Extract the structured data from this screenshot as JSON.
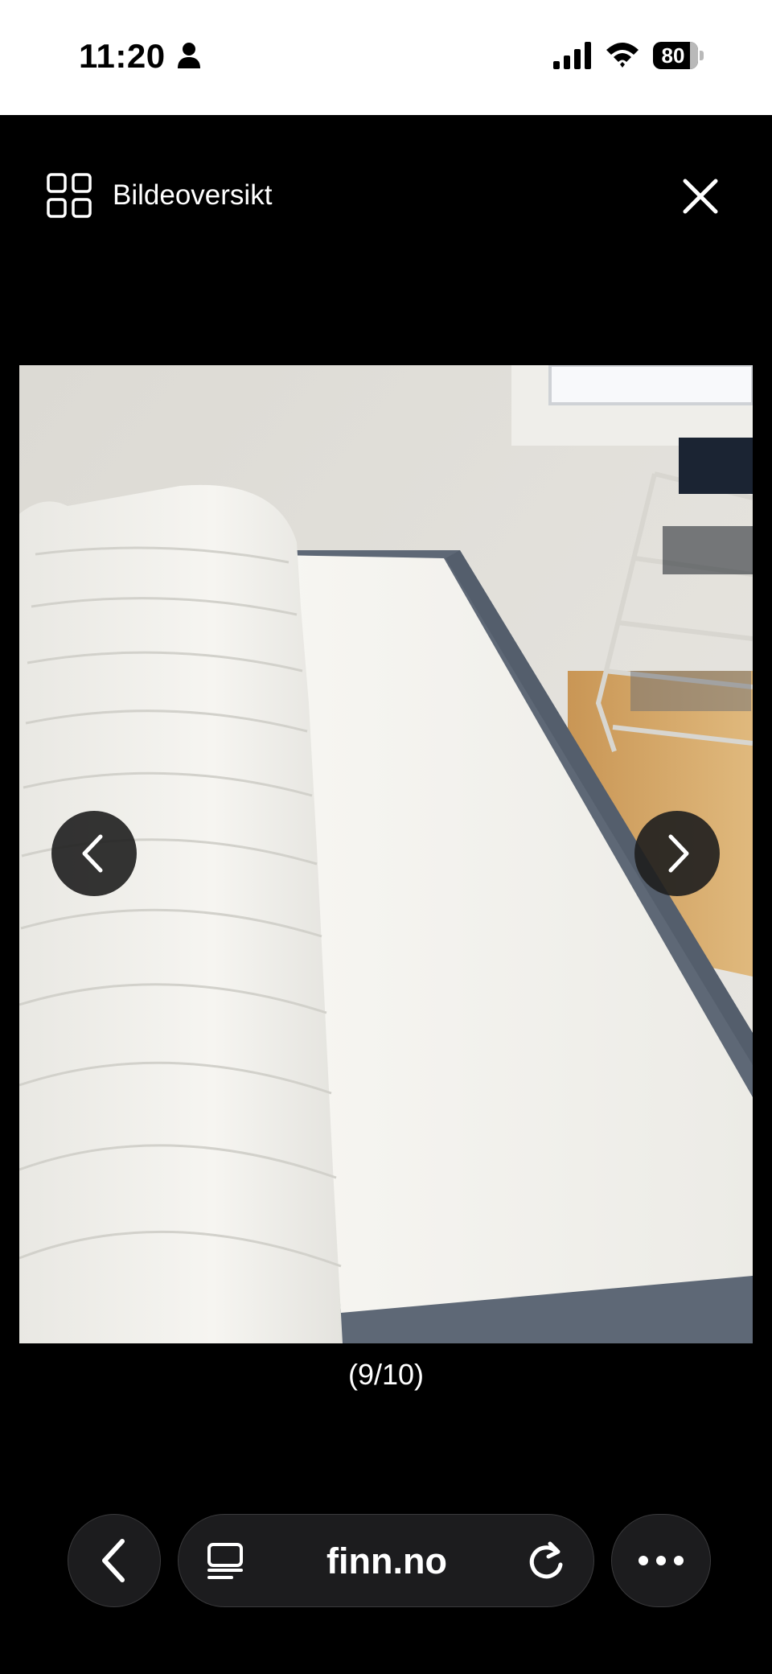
{
  "status_bar": {
    "time": "11:20",
    "battery": "80",
    "icons": [
      "person-icon",
      "signal-icon",
      "wifi-icon",
      "battery-icon"
    ]
  },
  "viewer": {
    "overview_label": "Bildeoversikt",
    "overview_icon": "grid-icon",
    "close_icon": "close-icon",
    "prev_icon": "chevron-left-icon",
    "next_icon": "chevron-right-icon",
    "counter": "(9/10)"
  },
  "toolbar": {
    "url": "finn.no",
    "back_icon": "chevron-left-icon",
    "reader_icon": "reader-icon",
    "reload_icon": "reload-icon",
    "more_icon": "more-icon"
  },
  "colors": {
    "background": "#000000",
    "toolbar_button": "#1c1c1e",
    "status_bar": "#ffffff"
  }
}
